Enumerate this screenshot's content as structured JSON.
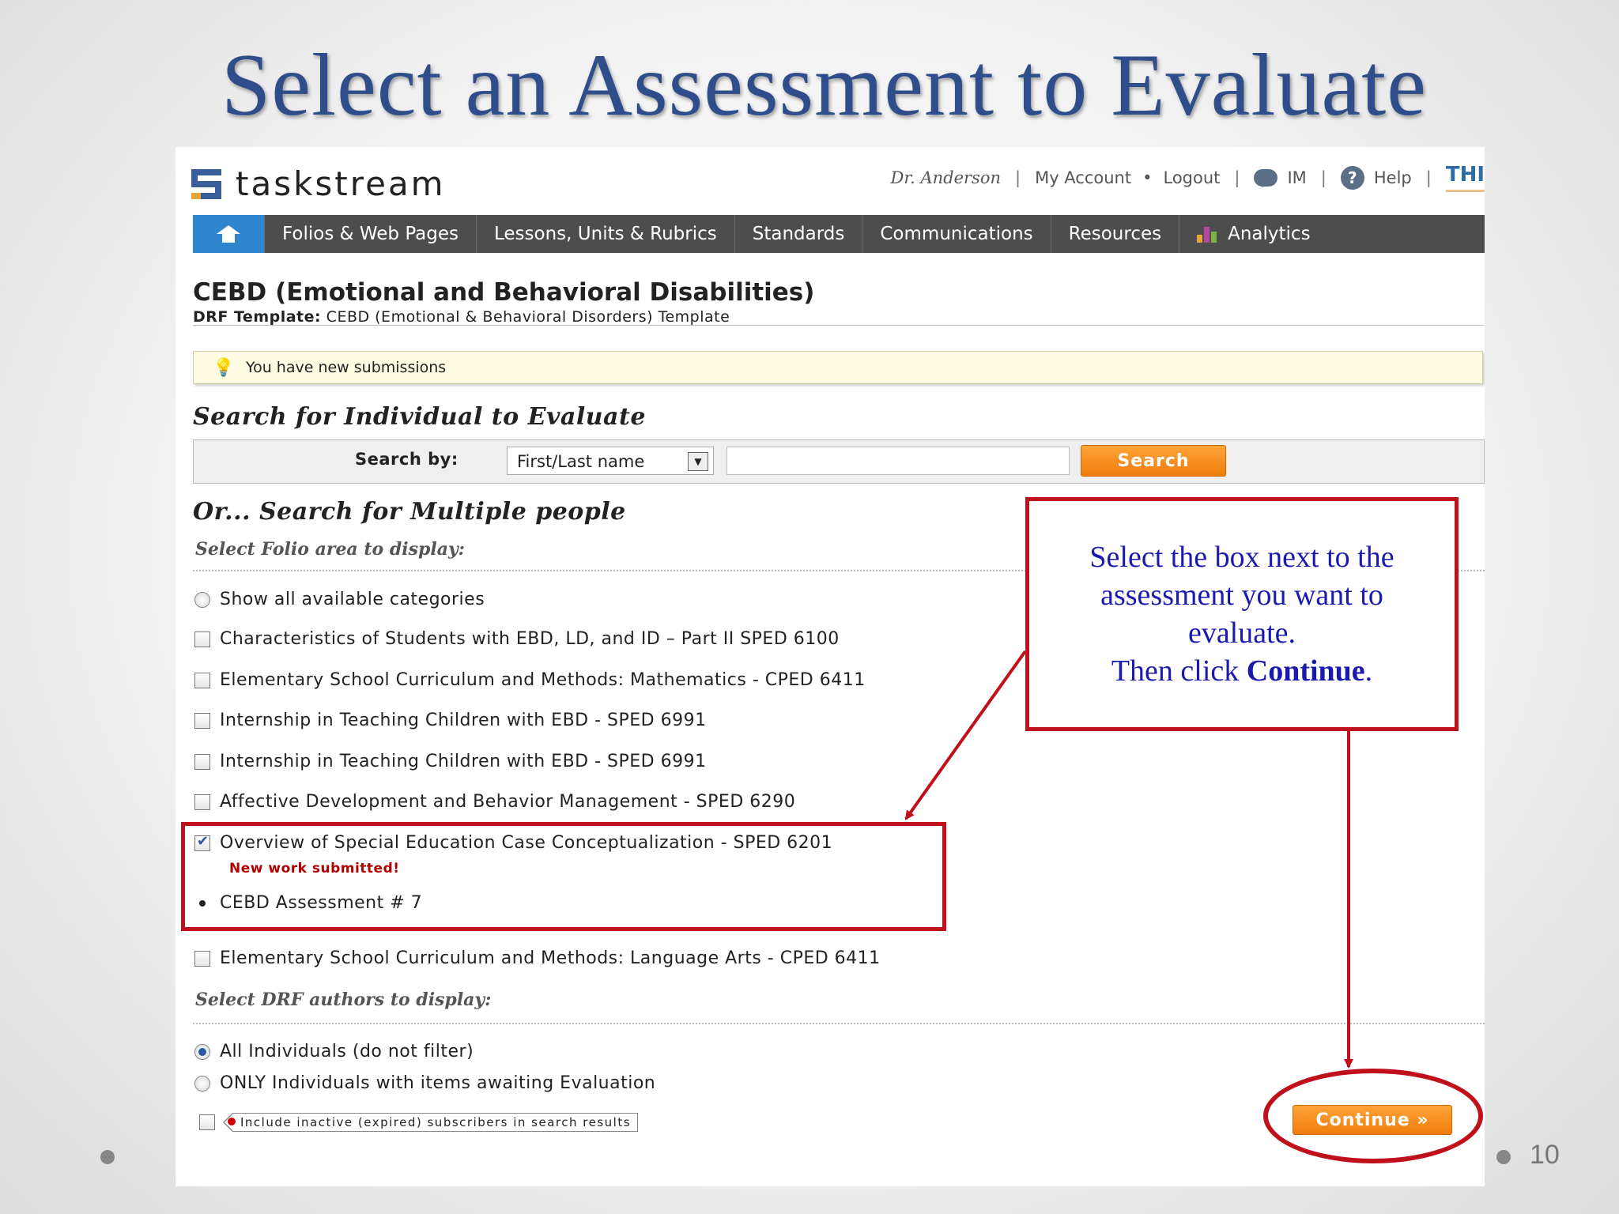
{
  "slide": {
    "title": "Select an Assessment to Evaluate",
    "number": "10",
    "callout": {
      "line1": "Select the box next to the",
      "line2": "assessment you want to",
      "line3": "evaluate.",
      "then": "Then click",
      "bold": "Continue",
      "end": "."
    }
  },
  "app": {
    "logo": "taskstream",
    "header": {
      "user": "Dr. Anderson",
      "my_account": "My Account",
      "logout": "Logout",
      "im": "IM",
      "help": "Help",
      "cut_link": "THI"
    },
    "nav": [
      "Folios & Web Pages",
      "Lessons, Units & Rubrics",
      "Standards",
      "Communications",
      "Resources",
      "Analytics"
    ],
    "page_title": "CEBD (Emotional and Behavioral Disabilities)",
    "drf_label": "DRF Template:",
    "drf_value": "CEBD (Emotional & Behavioral Disorders) Template",
    "notice": "You have new submissions",
    "search_heading": "Search for Individual to Evaluate",
    "search_by_label": "Search by:",
    "search_by_value": "First/Last name",
    "search_input_value": "",
    "search_button": "Search",
    "multi_heading": "Or... Search for Multiple people",
    "folio_area_label": "Select Folio area to display:",
    "show_all": "Show all available categories",
    "courses": [
      {
        "label": "Characteristics of Students with EBD, LD, and ID – Part II SPED 6100",
        "checked": false
      },
      {
        "label": "Elementary School Curriculum and Methods: Mathematics - CPED 6411",
        "checked": false
      },
      {
        "label": "Internship in Teaching Children with EBD - SPED 6991",
        "checked": false
      },
      {
        "label": "Internship in Teaching Children with EBD - SPED 6991",
        "checked": false
      },
      {
        "label": "Affective Development and Behavior Management - SPED 6290",
        "checked": false
      },
      {
        "label": "Overview of Special Education Case Conceptualization - SPED 6201",
        "checked": true
      },
      {
        "label": "Elementary School Curriculum and Methods: Language Arts - CPED 6411",
        "checked": false
      }
    ],
    "new_work": "New work submitted!",
    "assessment_item": "CEBD Assessment # 7",
    "authors_label": "Select DRF authors to display:",
    "all_individuals": "All Individuals (do not filter)",
    "only_individuals": "ONLY Individuals with items awaiting Evaluation",
    "inactive_label": "Include inactive (expired) subscribers in search results",
    "continue_button": "Continue »"
  },
  "colors": {
    "title": "#2e4d8a",
    "highlight": "#c0101c",
    "callout_text": "#1a1ab0",
    "nav_bg": "#4d4d4d",
    "home_tab": "#2f86cf",
    "button_orange": "#f07c0a"
  },
  "icons": {
    "home": "house-icon",
    "im": "chat-icon",
    "help": "help-icon",
    "notice": "lightbulb-icon",
    "analytics": "bar-chart-icon"
  }
}
